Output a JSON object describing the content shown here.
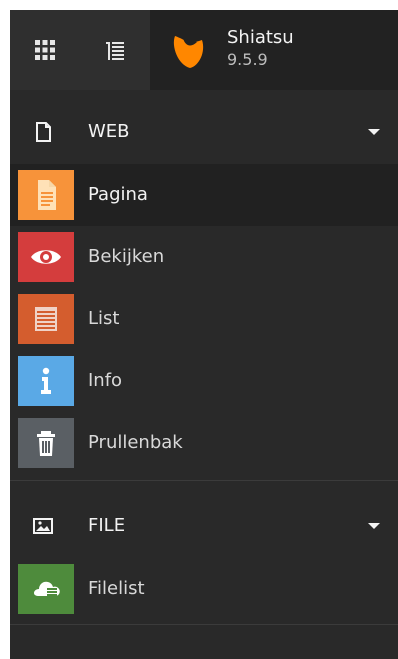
{
  "topbar": {
    "apps_icon": "apps-grid-icon",
    "tree_icon": "tree-list-icon",
    "site_name": "Shiatsu",
    "version": "9.5.9",
    "logo_icon": "typo3-logo-icon",
    "logo_color": "#ff8700"
  },
  "sections": {
    "web": {
      "label": "WEB",
      "icon": "document-icon",
      "caret": "caret-down-icon",
      "modules": [
        {
          "label": "Pagina",
          "icon": "page-icon",
          "color": "#f7933a",
          "active": true
        },
        {
          "label": "Bekijken",
          "icon": "eye-icon",
          "color": "#d43d3d",
          "active": false
        },
        {
          "label": "List",
          "icon": "list-icon",
          "color": "#d45d2e",
          "active": false
        },
        {
          "label": "Info",
          "icon": "info-icon",
          "color": "#5aa9e6",
          "active": false
        },
        {
          "label": "Prullenbak",
          "icon": "trash-icon",
          "color": "#5a5f64",
          "active": false
        }
      ]
    },
    "file": {
      "label": "FILE",
      "icon": "image-icon",
      "caret": "caret-down-icon",
      "modules": [
        {
          "label": "Filelist",
          "icon": "filelist-icon",
          "color": "#4e8b3c",
          "active": false
        }
      ]
    }
  }
}
